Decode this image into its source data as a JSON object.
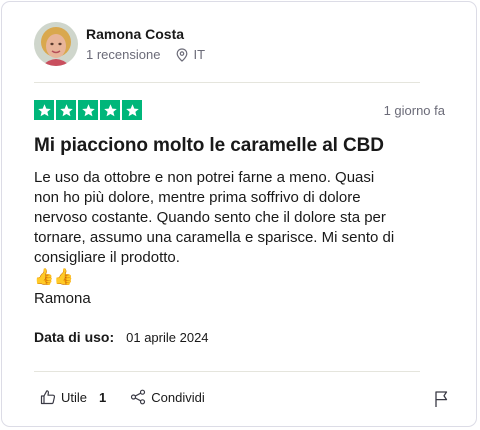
{
  "reviewer": {
    "name": "Ramona Costa",
    "reviews": "1 recensione",
    "country": "IT"
  },
  "review": {
    "rating": 5,
    "rating_color": "#00b67a",
    "date": "1 giorno fa",
    "title": "Mi piacciono molto le caramelle al CBD",
    "body_lines": [
      "Le uso da ottobre e non potrei farne a meno. Quasi",
      "non ho più dolore, mentre prima soffrivo di dolore",
      "nervoso costante. Quando sento che il dolore sta per",
      "tornare, assumo una caramella e sparisce. Mi sento di",
      "consigliare il prodotto."
    ],
    "emoji": "👍👍",
    "signature": "Ramona",
    "usage_label": "Data di uso:",
    "usage_date": "01 aprile 2024"
  },
  "actions": {
    "useful_label": "Utile",
    "useful_count": "1",
    "share_label": "Condividi"
  },
  "icons": [
    "location-pin-icon",
    "star-icon",
    "thumbs-up-icon",
    "share-icon",
    "flag-icon"
  ]
}
